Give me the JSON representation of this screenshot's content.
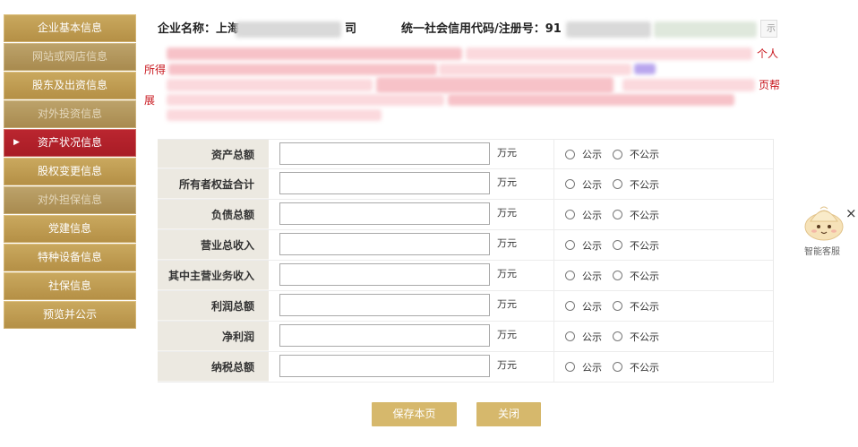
{
  "sidebar": {
    "items": [
      {
        "label": "企业基本信息",
        "state": "normal"
      },
      {
        "label": "网站或网店信息",
        "state": "disabled"
      },
      {
        "label": "股东及出资信息",
        "state": "normal"
      },
      {
        "label": "对外投资信息",
        "state": "disabled"
      },
      {
        "label": "资产状况信息",
        "state": "active"
      },
      {
        "label": "股权变更信息",
        "state": "normal"
      },
      {
        "label": "对外担保信息",
        "state": "disabled"
      },
      {
        "label": "党建信息",
        "state": "normal"
      },
      {
        "label": "特种设备信息",
        "state": "normal"
      },
      {
        "label": "社保信息",
        "state": "normal"
      },
      {
        "label": "预览并公示",
        "state": "normal"
      }
    ],
    "active_marker": "▶"
  },
  "header": {
    "company_label": "企业名称：上海",
    "company_suffix": "司",
    "code_label": "统一社会信用代码/注册号：91",
    "side_tag": "示"
  },
  "notice": {
    "fragments": [
      "个人",
      "所得",
      "页帮",
      "展"
    ]
  },
  "form": {
    "unit": "万元",
    "public_label": "公示",
    "private_label": "不公示",
    "rows": [
      {
        "label": "资产总额",
        "value": ""
      },
      {
        "label": "所有者权益合计",
        "value": ""
      },
      {
        "label": "负债总额",
        "value": ""
      },
      {
        "label": "营业总收入",
        "value": ""
      },
      {
        "label": "其中主营业务收入",
        "value": ""
      },
      {
        "label": "利润总额",
        "value": ""
      },
      {
        "label": "净利润",
        "value": ""
      },
      {
        "label": "纳税总额",
        "value": ""
      }
    ]
  },
  "buttons": {
    "save": "保存本页",
    "close": "关闭"
  },
  "widget": {
    "label": "智能客服",
    "close": "×",
    "icon": "customer-service-mascot-icon"
  },
  "colors": {
    "sidebar_gold": "#c4a257",
    "sidebar_active": "#b3222b",
    "button_gold": "#d6b86c",
    "notice_red": "#c8161d",
    "label_bg": "#ece9e1"
  }
}
